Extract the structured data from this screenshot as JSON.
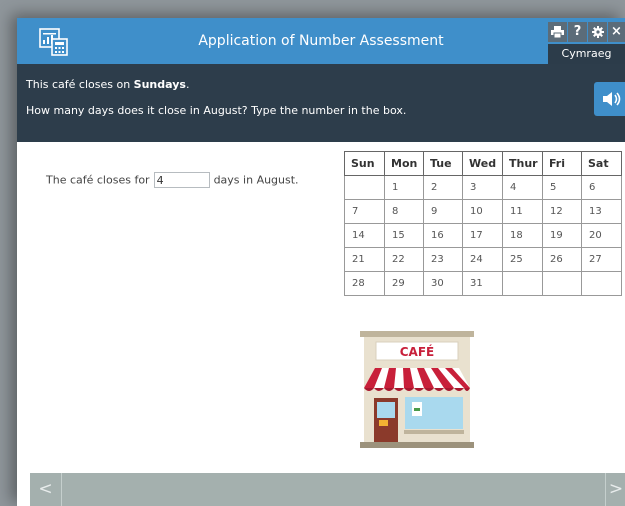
{
  "header": {
    "title": "Application of Number Assessment",
    "language_button": "Cymraeg",
    "buttons": {
      "print": "print-icon",
      "help": "?",
      "settings": "gear-icon",
      "close": "×"
    }
  },
  "question": {
    "line1_prefix": "This café closes on ",
    "line1_bold": "Sundays",
    "line1_suffix": ".",
    "line2": "How many days does it close in August? Type the number in the box."
  },
  "answer": {
    "prefix": "The café closes for",
    "value": "4",
    "suffix": "days in August."
  },
  "calendar": {
    "headers": [
      "Sun",
      "Mon",
      "Tue",
      "Wed",
      "Thur",
      "Fri",
      "Sat"
    ],
    "rows": [
      [
        "",
        "1",
        "2",
        "3",
        "4",
        "5",
        "6"
      ],
      [
        "7",
        "8",
        "9",
        "10",
        "11",
        "12",
        "13"
      ],
      [
        "14",
        "15",
        "16",
        "17",
        "18",
        "19",
        "20"
      ],
      [
        "21",
        "22",
        "23",
        "24",
        "25",
        "26",
        "27"
      ],
      [
        "28",
        "29",
        "30",
        "31",
        "",
        "",
        ""
      ]
    ]
  },
  "cafe_sign": "CAFÉ",
  "footer": {
    "prev": "<",
    "next": ">"
  },
  "colors": {
    "titlebar": "#3f8fca",
    "question_bar": "#2d3d4b",
    "footer": "#a4b0ae",
    "awning_red": "#c8203a"
  }
}
